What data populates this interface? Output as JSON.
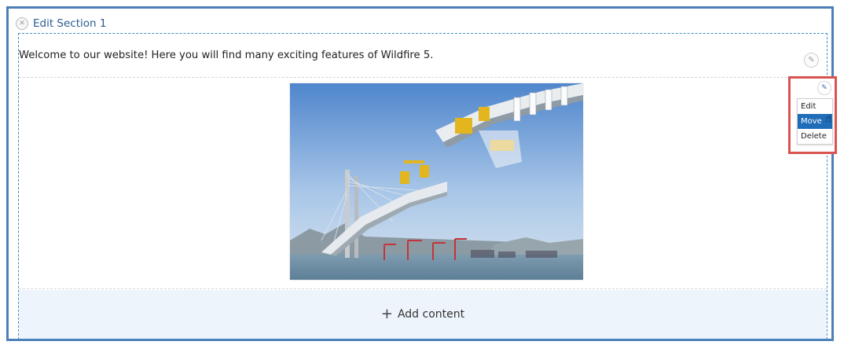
{
  "section": {
    "title": "Edit Section 1",
    "close_icon": "close-circle-icon"
  },
  "text_block": {
    "content": "Welcome to our website! Here you will find many exciting features of Wildfire 5.",
    "edit_icon": "pencil-icon"
  },
  "image_block": {
    "alt": "Photo of a cable-stayed bridge under construction with cranes at sea"
  },
  "add_content": {
    "plus_icon": "plus-icon",
    "label": "Add content"
  },
  "context_menu": {
    "edit_icon": "pencil-icon",
    "items": [
      {
        "label": "Edit",
        "active": false
      },
      {
        "label": "Move",
        "active": true
      },
      {
        "label": "Delete",
        "active": false
      }
    ],
    "highlight_color": "#d9534f",
    "active_color": "#1f6cb8"
  },
  "colors": {
    "frame_border": "#4d7fb8",
    "section_border": "#3d8fc7",
    "add_content_bg": "#eef4fb"
  }
}
